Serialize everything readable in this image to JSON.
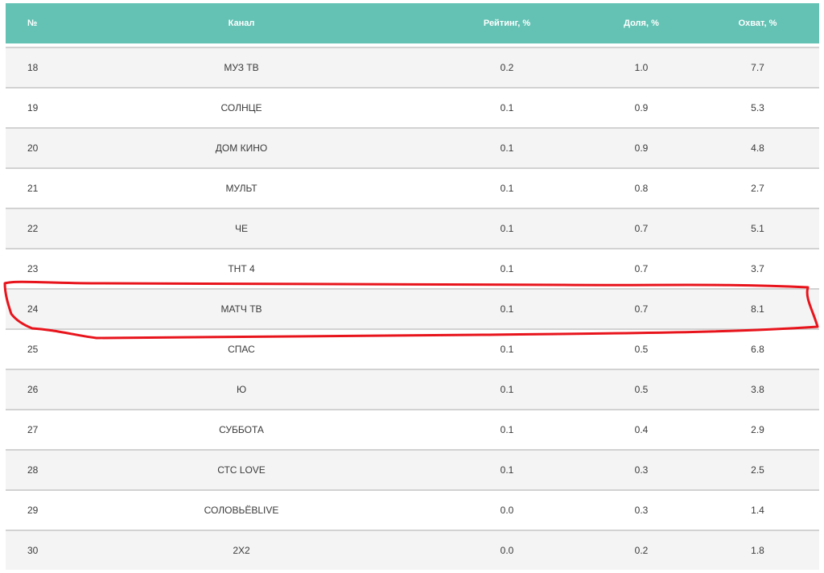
{
  "table": {
    "headers": {
      "num": "№",
      "channel": "Канал",
      "rating": "Рейтинг, %",
      "share": "Доля, %",
      "reach": "Охват, %"
    },
    "rows": [
      {
        "num": "18",
        "channel": "МУЗ ТВ",
        "rating": "0.2",
        "share": "1.0",
        "reach": "7.7"
      },
      {
        "num": "19",
        "channel": "СОЛНЦЕ",
        "rating": "0.1",
        "share": "0.9",
        "reach": "5.3"
      },
      {
        "num": "20",
        "channel": "ДОМ КИНО",
        "rating": "0.1",
        "share": "0.9",
        "reach": "4.8"
      },
      {
        "num": "21",
        "channel": "МУЛЬТ",
        "rating": "0.1",
        "share": "0.8",
        "reach": "2.7"
      },
      {
        "num": "22",
        "channel": "ЧЕ",
        "rating": "0.1",
        "share": "0.7",
        "reach": "5.1"
      },
      {
        "num": "23",
        "channel": "ТНТ 4",
        "rating": "0.1",
        "share": "0.7",
        "reach": "3.7"
      },
      {
        "num": "24",
        "channel": "МАТЧ ТВ",
        "rating": "0.1",
        "share": "0.7",
        "reach": "8.1"
      },
      {
        "num": "25",
        "channel": "СПАС",
        "rating": "0.1",
        "share": "0.5",
        "reach": "6.8"
      },
      {
        "num": "26",
        "channel": "Ю",
        "rating": "0.1",
        "share": "0.5",
        "reach": "3.8"
      },
      {
        "num": "27",
        "channel": "СУББОТА",
        "rating": "0.1",
        "share": "0.4",
        "reach": "2.9"
      },
      {
        "num": "28",
        "channel": "СТС LOVE",
        "rating": "0.1",
        "share": "0.3",
        "reach": "2.5"
      },
      {
        "num": "29",
        "channel": "СОЛОВЬЁВLIVE",
        "rating": "0.0",
        "share": "0.3",
        "reach": "1.4"
      },
      {
        "num": "30",
        "channel": "2Х2",
        "rating": "0.0",
        "share": "0.2",
        "reach": "1.8"
      }
    ]
  },
  "colors": {
    "header_bg": "#63c2b4",
    "highlight_stroke": "#e8141c"
  }
}
